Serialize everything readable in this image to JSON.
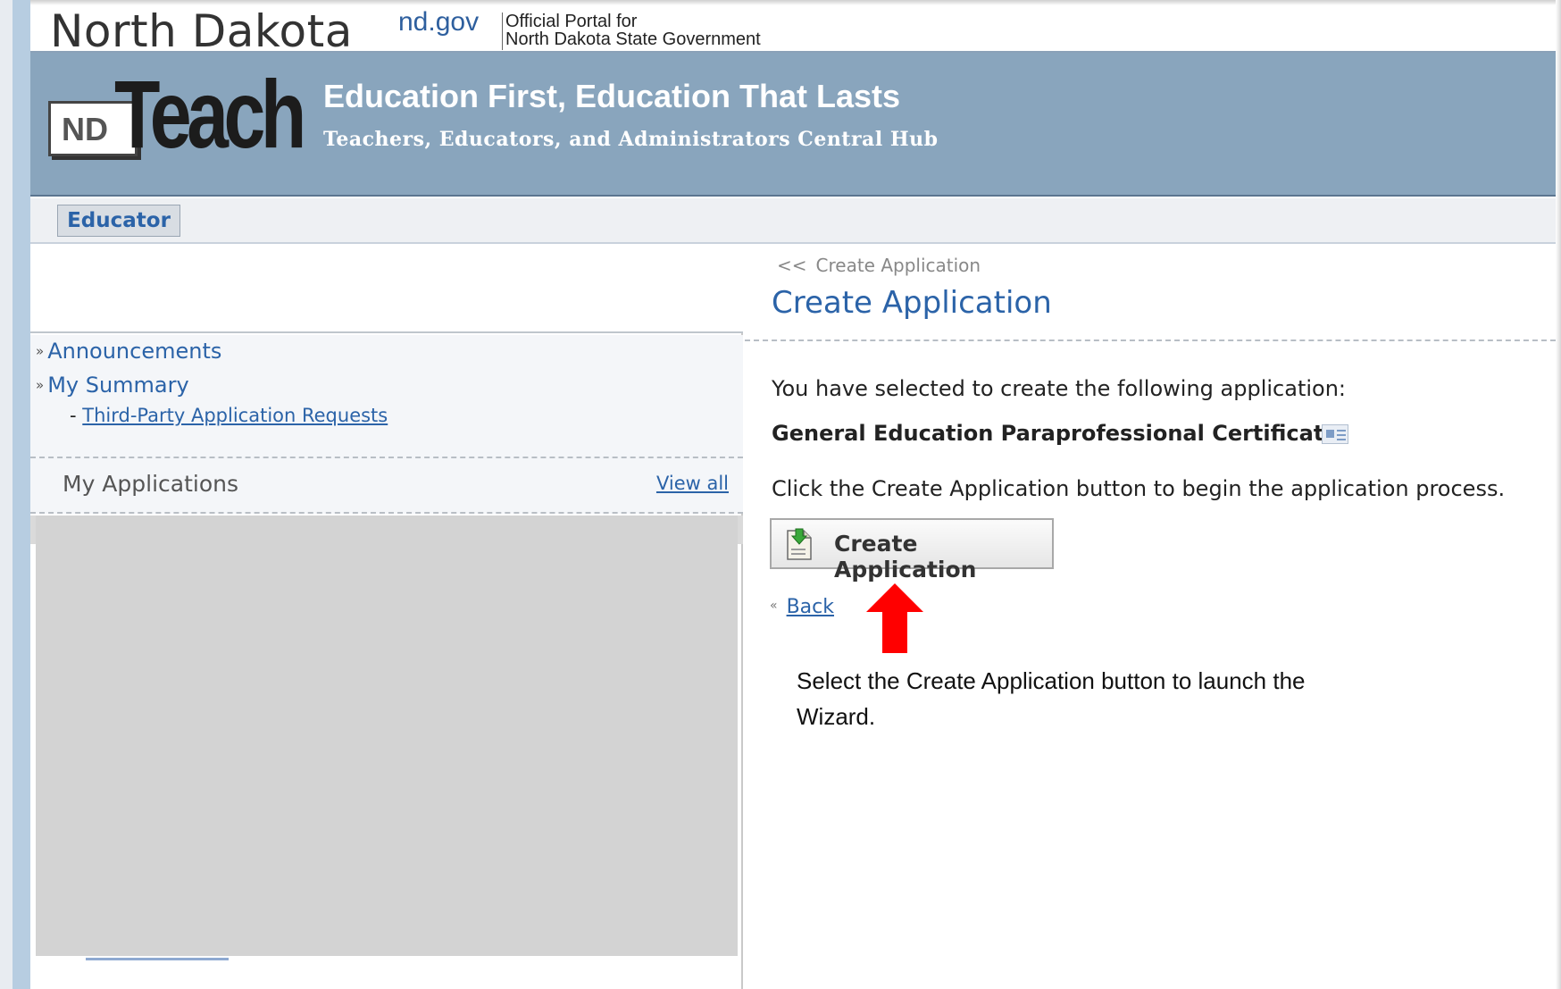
{
  "state_bar": {
    "state_name": "North Dakota",
    "portal_domain": "nd.gov",
    "portal_line1": "Official Portal for",
    "portal_line2": "North Dakota State Government"
  },
  "banner": {
    "logo_nd": "ND",
    "logo_teach": "Teach",
    "title": "Education First, Education That Lasts",
    "subtitle": "Teachers, Educators, and Administrators Central Hub",
    "background_color": "#89a5bd"
  },
  "role_tab": {
    "label": "Educator"
  },
  "sidebar": {
    "chevron": "»",
    "nav_items": [
      {
        "label": "Announcements"
      },
      {
        "label": "My Summary"
      }
    ],
    "sub_prefix": "-",
    "sub_item": "Third-Party Application Requests",
    "my_applications": {
      "title": "My Applications",
      "view_all": "View all"
    }
  },
  "main": {
    "breadcrumb_chevron": "<<",
    "breadcrumb": "Create Application",
    "title": "Create Application",
    "selected_message": "You have selected to create the following application:",
    "certificate_name": "General Education Paraprofessional Certificate",
    "certificate_icon": "certificate-card-icon",
    "click_message": "Click the Create Application button to begin the application process.",
    "create_button_label": "Create Application",
    "create_button_icon": "document-add-icon",
    "back_chevron": "«",
    "back_label": "Back"
  },
  "annotation": {
    "arrow_color": "#ff0000",
    "callout_text": "Select the Create Application button to launch the Wizard."
  },
  "colors": {
    "link": "#2b63a8",
    "banner": "#89a5bd",
    "sidebar_accent": "#b7cde1"
  }
}
